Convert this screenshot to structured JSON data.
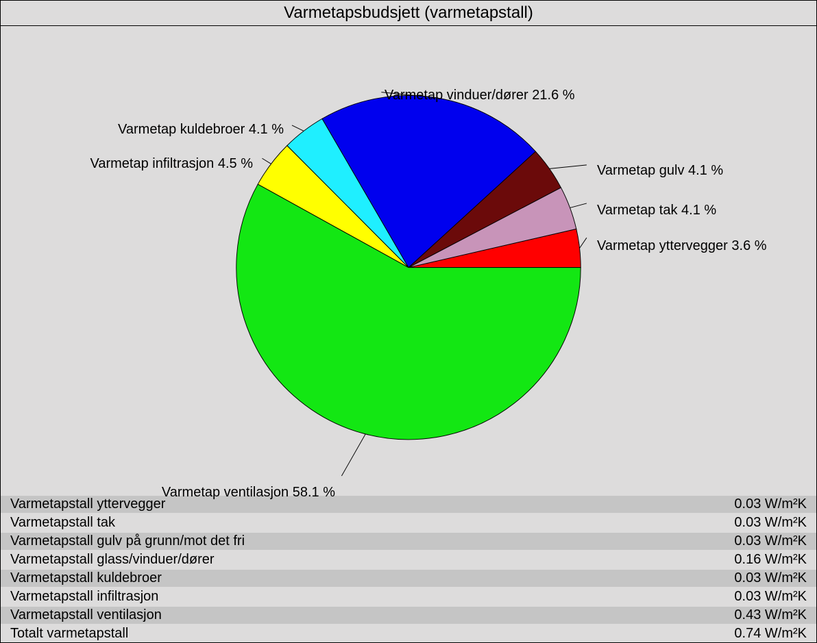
{
  "title": "Varmetapsbudsjett (varmetapstall)",
  "chart_data": {
    "type": "pie",
    "title": "Varmetapsbudsjett (varmetapstall)",
    "series": [
      {
        "name": "Varmetap yttervegger",
        "value": 3.6,
        "color": "#ff0000",
        "label": "Varmetap yttervegger 3.6 %"
      },
      {
        "name": "Varmetap tak",
        "value": 4.1,
        "color": "#c894b9",
        "label": "Varmetap tak 4.1 %"
      },
      {
        "name": "Varmetap gulv",
        "value": 4.1,
        "color": "#6b0a0a",
        "label": "Varmetap gulv 4.1 %"
      },
      {
        "name": "Varmetap vinduer/dører",
        "value": 21.6,
        "color": "#0000ee",
        "label": "Varmetap vinduer/dører 21.6 %"
      },
      {
        "name": "Varmetap kuldebroer",
        "value": 4.1,
        "color": "#1fefff",
        "label": "Varmetap kuldebroer 4.1 %"
      },
      {
        "name": "Varmetap infiltrasjon",
        "value": 4.5,
        "color": "#ffff00",
        "label": "Varmetap infiltrasjon 4.5 %"
      },
      {
        "name": "Varmetap ventilasjon",
        "value": 58.1,
        "color": "#13e713",
        "label": "Varmetap ventilasjon 58.1 %"
      }
    ]
  },
  "table": {
    "rows": [
      {
        "label": "Varmetapstall yttervegger",
        "value": "0.03 W/m²K"
      },
      {
        "label": "Varmetapstall tak",
        "value": "0.03 W/m²K"
      },
      {
        "label": "Varmetapstall gulv på grunn/mot det fri",
        "value": "0.03 W/m²K"
      },
      {
        "label": "Varmetapstall glass/vinduer/dører",
        "value": "0.16 W/m²K"
      },
      {
        "label": "Varmetapstall kuldebroer",
        "value": "0.03 W/m²K"
      },
      {
        "label": "Varmetapstall infiltrasjon",
        "value": "0.03 W/m²K"
      },
      {
        "label": "Varmetapstall ventilasjon",
        "value": "0.43 W/m²K"
      },
      {
        "label": "Totalt varmetapstall",
        "value": "0.74 W/m²K"
      }
    ]
  }
}
